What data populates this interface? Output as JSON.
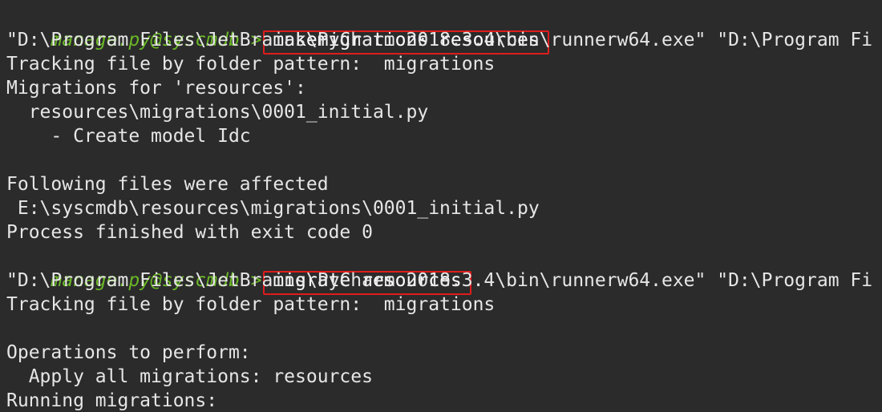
{
  "console": {
    "lines": [
      {
        "kind": "prompt",
        "prompt": "manage.py@syscmdb > ",
        "command": "makemigrations resources",
        "highlighted": true
      },
      {
        "kind": "output",
        "text": "\"D:\\Program Files\\JetBrains\\PyCharm 2018.3.4\\bin\\runnerw64.exe\" \"D:\\Program Fi"
      },
      {
        "kind": "output",
        "text": "Tracking file by folder pattern:  migrations"
      },
      {
        "kind": "output",
        "text": "Migrations for 'resources':"
      },
      {
        "kind": "output",
        "text": "  resources\\migrations\\0001_initial.py"
      },
      {
        "kind": "output",
        "text": "    - Create model Idc"
      },
      {
        "kind": "blank",
        "text": ""
      },
      {
        "kind": "output",
        "text": "Following files were affected"
      },
      {
        "kind": "output",
        "text": " E:\\syscmdb\\resources\\migrations\\0001_initial.py"
      },
      {
        "kind": "output",
        "text": "Process finished with exit code 0"
      },
      {
        "kind": "prompt",
        "prompt": "manage.py@syscmdb > ",
        "command": "migrate resources",
        "highlighted": true
      },
      {
        "kind": "output",
        "text": "\"D:\\Program Files\\JetBrains\\PyCharm 2018.3.4\\bin\\runnerw64.exe\" \"D:\\Program Fi"
      },
      {
        "kind": "output",
        "text": "Tracking file by folder pattern:  migrations"
      },
      {
        "kind": "blank",
        "text": ""
      },
      {
        "kind": "output",
        "text": "Operations to perform:"
      },
      {
        "kind": "output",
        "text": "  Apply all migrations: resources"
      },
      {
        "kind": "output",
        "text": "Running migrations:"
      }
    ]
  },
  "colors": {
    "background": "#2b2b2b",
    "text": "#e6e6e6",
    "prompt": "#6ab825",
    "highlight_box": "#e01c1c"
  }
}
